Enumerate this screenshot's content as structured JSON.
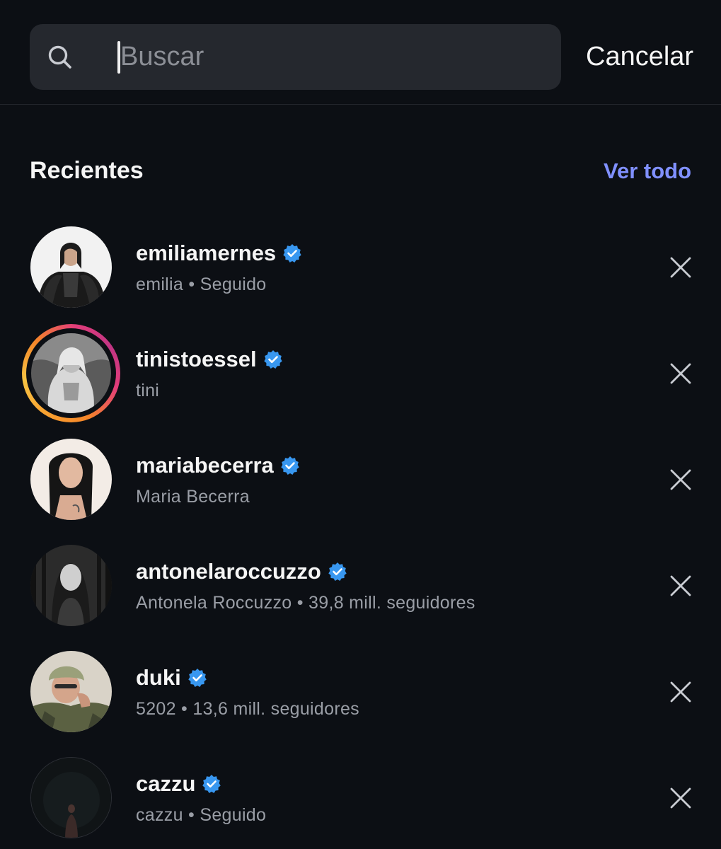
{
  "search": {
    "placeholder": "Buscar",
    "value": "",
    "cancel_label": "Cancelar"
  },
  "section": {
    "title": "Recientes",
    "see_all_label": "Ver todo"
  },
  "recents": [
    {
      "username": "emiliamernes",
      "subtitle": "emilia • Seguido",
      "verified": true,
      "has_story": false
    },
    {
      "username": "tinistoessel",
      "subtitle": "tini",
      "verified": true,
      "has_story": true
    },
    {
      "username": "mariabecerra",
      "subtitle": "Maria Becerra",
      "verified": true,
      "has_story": false
    },
    {
      "username": "antonelaroccuzzo",
      "subtitle": "Antonela Roccuzzo • 39,8 mill. seguidores",
      "verified": true,
      "has_story": false
    },
    {
      "username": "duki",
      "subtitle": "5202 • 13,6 mill. seguidores",
      "verified": true,
      "has_story": false
    },
    {
      "username": "cazzu",
      "subtitle": "cazzu • Seguido",
      "verified": true,
      "has_story": false
    }
  ],
  "colors": {
    "background": "#0c0f14",
    "search_bg": "#25282e",
    "link": "#8090ff",
    "verified": "#3897f0",
    "secondary_text": "#9a9ea6"
  },
  "icons": {
    "search": "search-icon",
    "verified": "verified-badge-icon",
    "remove": "close-icon"
  }
}
